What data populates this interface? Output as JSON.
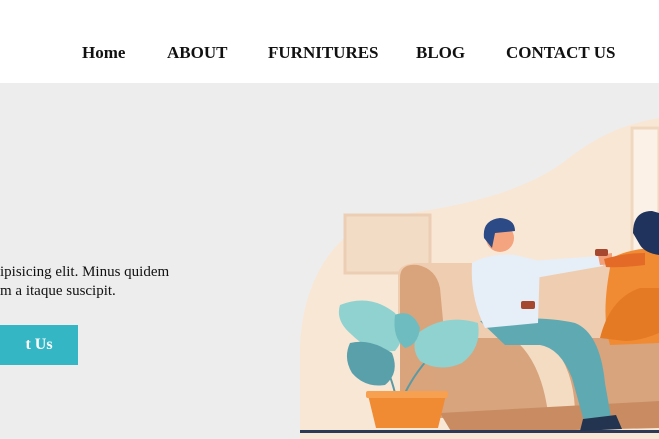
{
  "nav": {
    "items": [
      {
        "label": "Home"
      },
      {
        "label": "ABOUT"
      },
      {
        "label": "FURNITURES"
      },
      {
        "label": "BLOG"
      },
      {
        "label": "CONTACT US"
      }
    ]
  },
  "hero": {
    "text_line1": "ipisicing elit. Minus quidem",
    "text_line2": "m a itaque suscipit.",
    "cta_label": "t Us"
  },
  "colors": {
    "nav_background": "#ffffff",
    "hero_background": "#ededed",
    "cta_background": "#35b6c4",
    "cta_text": "#ffffff"
  },
  "illustration": {
    "subject": "couple relaxing on sofa with tea and a potted plant"
  }
}
